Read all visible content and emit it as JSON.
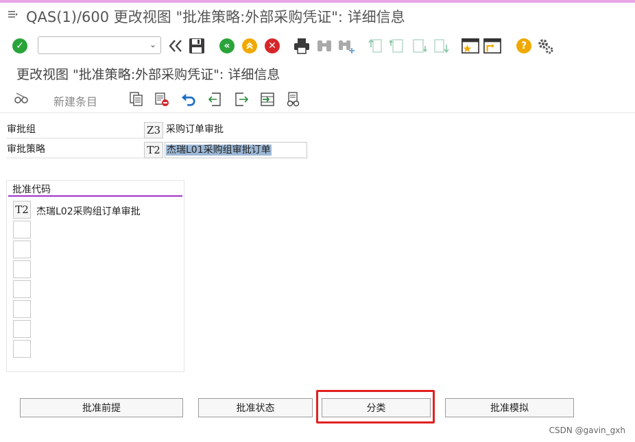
{
  "window": {
    "title": "QAS(1)/600 更改视图 \"批准策略:外部采购凭证\": 详细信息"
  },
  "page": {
    "title": "更改视图 \"批准策略:外部采购凭证\": 详细信息"
  },
  "toolbar": {
    "command_value": ""
  },
  "app_toolbar": {
    "new_entries_label": "新建条目"
  },
  "fields": {
    "release_group": {
      "label": "审批组",
      "code": "Z3",
      "description": "采购订单审批"
    },
    "release_strategy": {
      "label": "审批策略",
      "code": "T2",
      "description": "杰瑞L01采购组审批订单"
    }
  },
  "release_codes": {
    "header": "批准代码",
    "rows": [
      {
        "code": "T2",
        "description": "杰瑞L02采购组订单审批"
      },
      {
        "code": "",
        "description": ""
      },
      {
        "code": "",
        "description": ""
      },
      {
        "code": "",
        "description": ""
      },
      {
        "code": "",
        "description": ""
      },
      {
        "code": "",
        "description": ""
      },
      {
        "code": "",
        "description": ""
      },
      {
        "code": "",
        "description": ""
      }
    ]
  },
  "buttons": {
    "prerequisites": "批准前提",
    "status": "批准状态",
    "classification": "分类",
    "simulation": "批准模拟"
  },
  "watermark": "CSDN @gavin_gxh",
  "colors": {
    "accent_line": "#a030c8",
    "highlight": "#e02020",
    "selection": "#9db8d6"
  }
}
